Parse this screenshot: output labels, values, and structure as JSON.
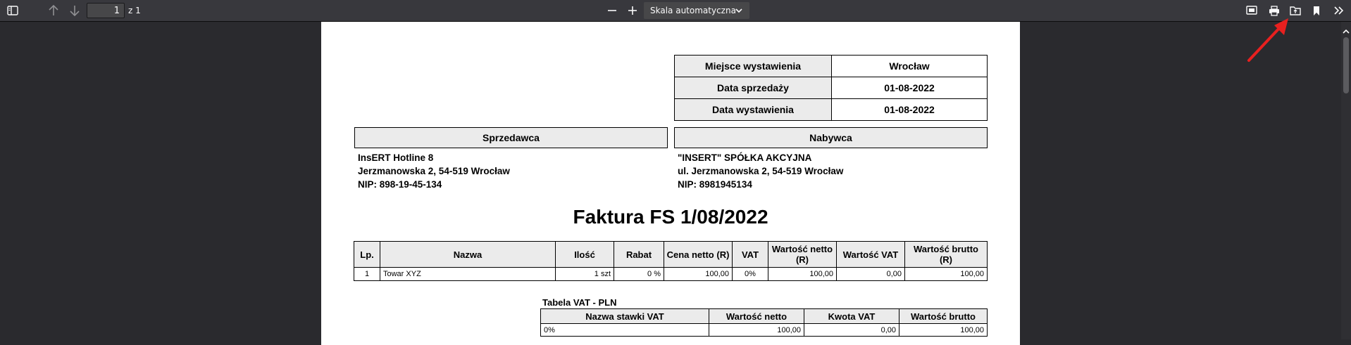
{
  "toolbar": {
    "page_current": "1",
    "page_of": "z 1",
    "scale_label": "Skala automatyczna"
  },
  "invoice": {
    "meta": [
      {
        "label": "Miejsce wystawienia",
        "value": "Wrocław"
      },
      {
        "label": "Data sprzedaży",
        "value": "01-08-2022"
      },
      {
        "label": "Data wystawienia",
        "value": "01-08-2022"
      }
    ],
    "seller": {
      "header": "Sprzedawca",
      "lines": [
        "InsERT Hotline 8",
        "Jerzmanowska 2, 54-519 Wrocław",
        "NIP: 898-19-45-134"
      ]
    },
    "buyer": {
      "header": "Nabywca",
      "lines": [
        "\"INSERT\" SPÓŁKA AKCYJNA",
        "ul. Jerzmanowska 2, 54-519 Wrocław",
        "NIP: 8981945134"
      ]
    },
    "title": "Faktura FS 1/08/2022",
    "items_headers": [
      "Lp.",
      "Nazwa",
      "Ilość",
      "Rabat",
      "Cena netto (R)",
      "VAT",
      "Wartość netto (R)",
      "Wartość VAT",
      "Wartość brutto (R)"
    ],
    "items_rows": [
      [
        "1",
        "Towar XYZ",
        "1 szt",
        "0 %",
        "100,00",
        "0%",
        "100,00",
        "0,00",
        "100,00"
      ]
    ],
    "vat_label": "Tabela VAT - PLN",
    "vat_headers": [
      "Nazwa stawki VAT",
      "Wartość netto",
      "Kwota VAT",
      "Wartość brutto"
    ],
    "vat_rows": [
      [
        "0%",
        "100,00",
        "0,00",
        "100,00"
      ]
    ]
  },
  "colors": {
    "toolbar_bg": "#38383d",
    "viewer_bg": "#2a2a2e",
    "header_cell_bg": "#ebebeb",
    "annotation_arrow": "#e8201f"
  }
}
